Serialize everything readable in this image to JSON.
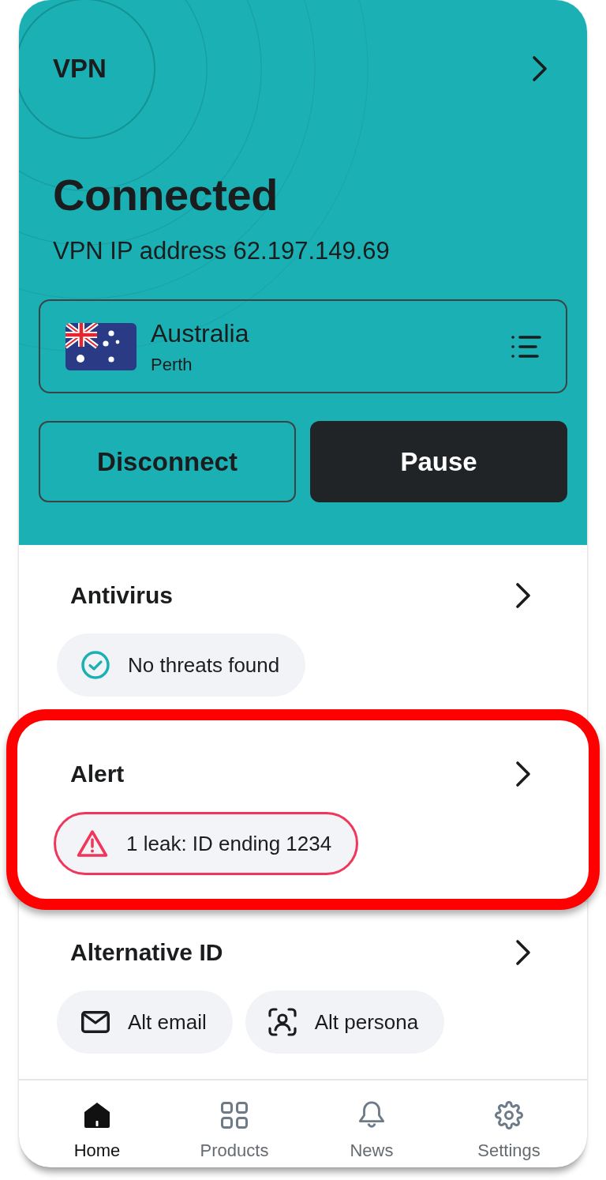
{
  "vpn": {
    "title": "VPN",
    "status": "Connected",
    "ip_address": "VPN IP address 62.197.149.69",
    "location": {
      "country": "Australia",
      "city": "Perth"
    },
    "buttons": [
      {
        "label": "Disconnect",
        "kind": "outline"
      },
      {
        "label": "Pause",
        "kind": "filled"
      }
    ]
  },
  "sections": [
    {
      "title": "Antivirus",
      "highlighted": false,
      "chips": [
        {
          "label": "No threats found",
          "kind": "ok"
        }
      ]
    },
    {
      "title": "Alert",
      "highlighted": true,
      "chips": [
        {
          "label": "1 leak: ID ending 1234",
          "kind": "warning"
        }
      ]
    },
    {
      "title": "Alternative ID",
      "highlighted": false,
      "chips": [
        {
          "label": "Alt email",
          "kind": "email"
        },
        {
          "label": "Alt persona",
          "kind": "persona"
        }
      ]
    }
  ],
  "bottom_nav": [
    {
      "label": "Home",
      "selected": true
    },
    {
      "label": "Products",
      "selected": false
    },
    {
      "label": "News",
      "selected": false
    },
    {
      "label": "Settings",
      "selected": false
    }
  ]
}
